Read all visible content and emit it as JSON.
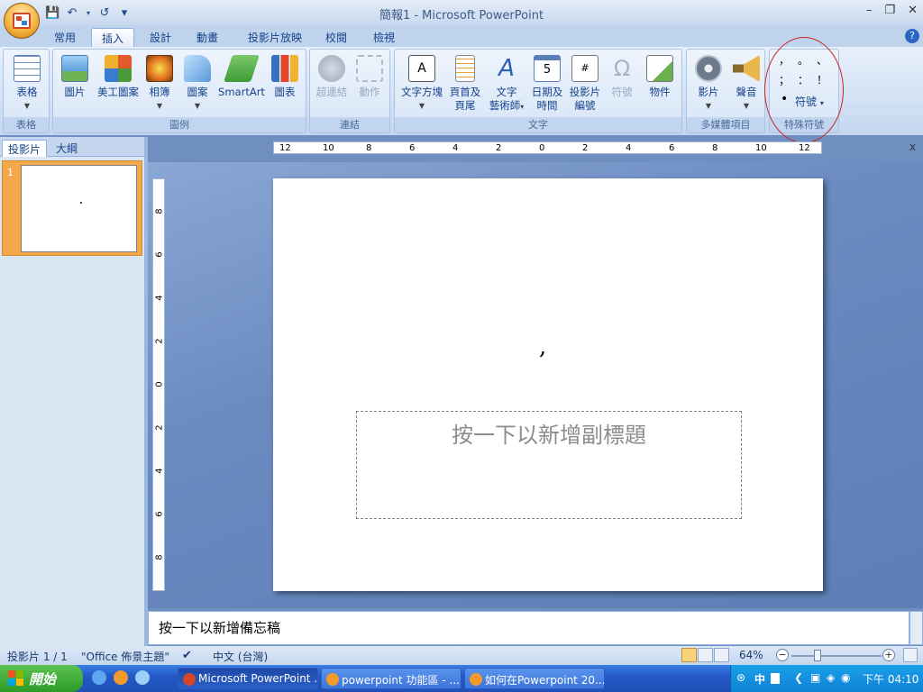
{
  "window": {
    "title": "簡報1 - Microsoft PowerPoint"
  },
  "qat": {
    "save": "💾",
    "undo": "↶",
    "redo": "↺",
    "more": "▾"
  },
  "tabs": [
    {
      "label": "常用"
    },
    {
      "label": "插入",
      "active": true
    },
    {
      "label": "設計"
    },
    {
      "label": "動畫"
    },
    {
      "label": "投影片放映"
    },
    {
      "label": "校閱"
    },
    {
      "label": "檢視"
    }
  ],
  "ribbon": {
    "groups": {
      "table": "表格",
      "illustrations": "圖例",
      "links": "連結",
      "text": "文字",
      "media": "多媒體項目",
      "symbols": "特殊符號"
    },
    "buttons": {
      "table": "表格",
      "picture": "圖片",
      "clipart": "美工圖案",
      "album_1": "相簿",
      "shapes": "圖案",
      "smartart": "SmartArt",
      "chart": "圖表",
      "hyperlink": "超連結",
      "action": "動作",
      "textbox": "文字方塊",
      "header_1": "頁首及",
      "header_2": "頁尾",
      "wordart_1": "文字",
      "wordart_2": "藝術師",
      "datetime_1": "日期及",
      "datetime_2": "時間",
      "slidenum_1": "投影片",
      "slidenum_2": "編號",
      "symbol": "符號",
      "object": "物件",
      "movie": "影片",
      "sound": "聲音"
    },
    "symbol_glyphs": [
      "，",
      "。",
      "、",
      "；",
      "：",
      "！"
    ],
    "symbol_bullet": "•",
    "symbol_menu": "符號"
  },
  "left_pane": {
    "tab_slides": "投影片",
    "tab_outline": "大綱",
    "close": "x",
    "slide_number": "1"
  },
  "rulers": {
    "h": [
      "12",
      "10",
      "8",
      "6",
      "4",
      "2",
      "0",
      "2",
      "4",
      "6",
      "8",
      "10",
      "12"
    ],
    "v": [
      "8",
      "6",
      "4",
      "2",
      "0",
      "2",
      "4",
      "6",
      "8"
    ]
  },
  "slide": {
    "title_text": ",",
    "subtitle_placeholder": "按一下以新增副標題"
  },
  "notes": {
    "placeholder": "按一下以新增備忘稿"
  },
  "statusbar": {
    "slide_pos": "投影片 1 / 1",
    "theme": "\"Office 佈景主題\"",
    "language": "中文 (台灣)",
    "zoom": "64%"
  },
  "taskbar": {
    "start": "開始",
    "tasks": [
      {
        "label": "Microsoft PowerPoint ...",
        "active": true
      },
      {
        "label": "powerpoint 功能區 - ..."
      },
      {
        "label": "如何在Powerpoint 20..."
      }
    ],
    "tray_lang": "中",
    "clock": "下午 04:10"
  },
  "colors": {
    "accent": "#d24726",
    "annotation": "#d02020",
    "active_thumb": "#f4a84a"
  }
}
